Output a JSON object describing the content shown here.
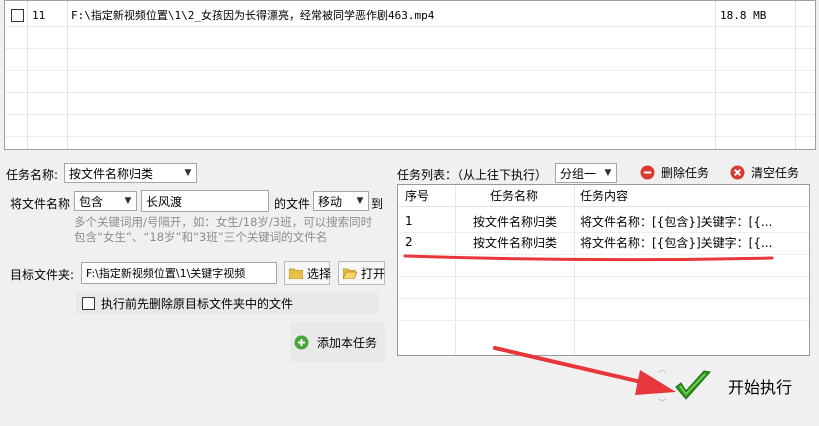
{
  "file_list": {
    "rows": [
      {
        "index": "11",
        "path": "F:\\指定新视频位置\\1\\2_女孩因为长得漂亮，经常被同学恶作剧463.mp4",
        "size": "18.8 MB"
      }
    ]
  },
  "task_config": {
    "task_name_label": "任务名称:",
    "task_name_value": "按文件名称归类",
    "filename_label": "将文件名称",
    "match_mode": "包含",
    "keyword": "长风渡",
    "of_file_label": "的文件",
    "action": "移动",
    "to_label": "到",
    "hint_line1": "多个关键词用/号隔开，如：女生/18岁/3班，可以搜索同时",
    "hint_line2": "包含“女生”、“18岁”和“3班”三个关键词的文件名",
    "target_folder_label": "目标文件夹:",
    "target_folder_value": "F:\\指定新视频位置\\1\\关键字视频",
    "select_button": "选择",
    "open_button": "打开",
    "clear_before_label": "执行前先删除原目标文件夹中的文件",
    "add_task_button": "添加本任务"
  },
  "task_list": {
    "label": "任务列表：（从上往下执行）",
    "group": "分组一",
    "delete_button": "删除任务",
    "clear_button": "清空任务",
    "headers": {
      "no": "序号",
      "name": "任务名称",
      "content": "任务内容"
    },
    "rows": [
      {
        "no": "1",
        "name": "按文件名称归类",
        "content": "将文件名称：[{包含}]关键字：[{..."
      },
      {
        "no": "2",
        "name": "按文件名称归类",
        "content": "将文件名称：[{包含}]关键字：[{..."
      }
    ]
  },
  "start_button": "开始执行",
  "colors": {
    "annotation_red": "#e8373a",
    "start_check_green": "#2f9a1d",
    "delete_red": "#d83b2f"
  }
}
